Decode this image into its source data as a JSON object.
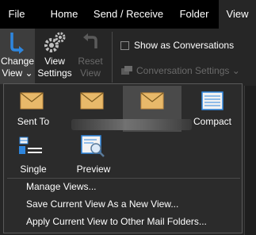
{
  "tabs": [
    {
      "label": "File",
      "active": false
    },
    {
      "label": "Home",
      "active": false
    },
    {
      "label": "Send / Receive",
      "active": false
    },
    {
      "label": "Folder",
      "active": false
    },
    {
      "label": "View",
      "active": true
    }
  ],
  "ribbon": {
    "change_view": {
      "line1": "Change",
      "line2": "View ⌄"
    },
    "view_settings": {
      "line1": "View",
      "line2": "Settings"
    },
    "reset_view": {
      "line1": "Reset",
      "line2": "View",
      "disabled": true
    },
    "show_as_conversations": {
      "label": "Show as Conversations",
      "checked": false
    },
    "conversation_settings": {
      "label": "Conversation Settings ⌄",
      "disabled": true
    }
  },
  "dropdown": {
    "views": [
      {
        "label": "Sent To",
        "icon": "envelope-icon",
        "selected": false
      },
      {
        "label": "",
        "icon": "envelope-icon",
        "selected": false
      },
      {
        "label": "",
        "icon": "envelope-icon",
        "selected": true
      },
      {
        "label": "Compact",
        "icon": "compact-list-icon",
        "selected": false
      },
      {
        "label": "Single",
        "icon": "single-list-icon",
        "selected": false
      },
      {
        "label": "Preview",
        "icon": "preview-icon",
        "selected": false
      }
    ],
    "menu": [
      {
        "label": "Manage Views..."
      },
      {
        "label": "Save Current View As a New View..."
      },
      {
        "label": "Apply Current View to Other Mail Folders..."
      }
    ]
  },
  "colors": {
    "tabbar_bg": "#000000",
    "ribbon_bg": "#262626",
    "accent_blue": "#2e86de",
    "envelope": "#e8b96a",
    "menu_bg": "#2b2b2b",
    "selected_bg": "#4a4a4a"
  }
}
